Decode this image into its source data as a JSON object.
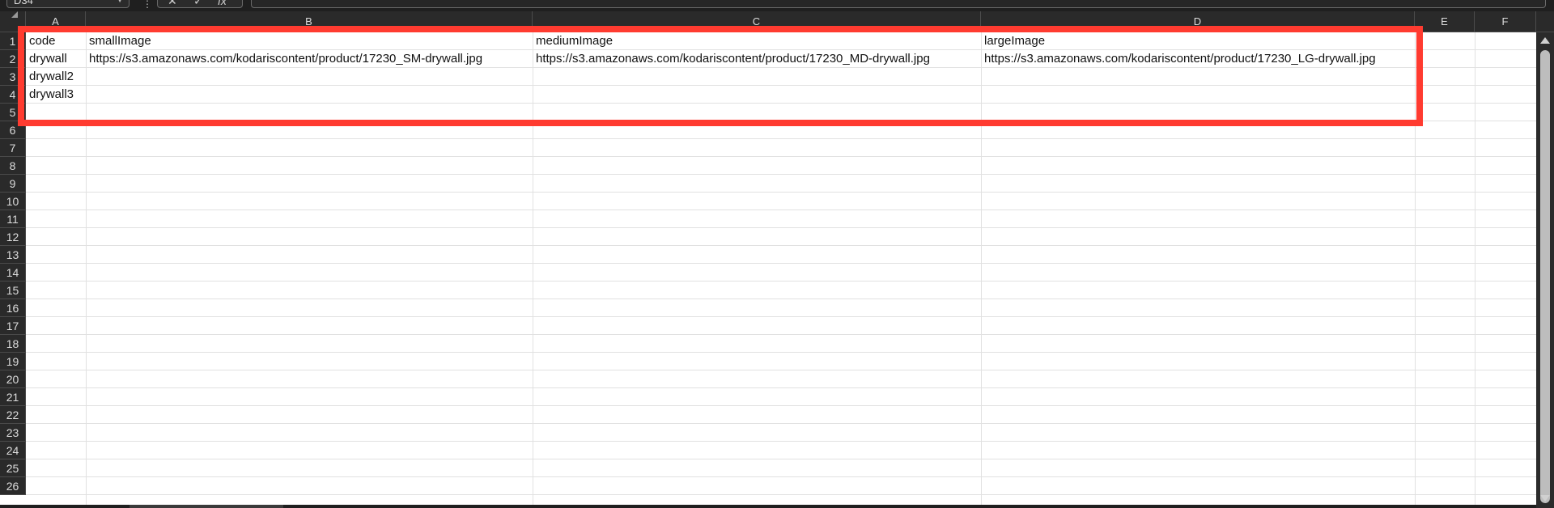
{
  "formula_bar": {
    "name_box": "D34",
    "fx_label": "fx",
    "cancel_symbol": "✕",
    "enter_symbol": "✓",
    "formula_value": ""
  },
  "columns": [
    {
      "id": "A",
      "label": "A"
    },
    {
      "id": "B",
      "label": "B"
    },
    {
      "id": "C",
      "label": "C"
    },
    {
      "id": "D",
      "label": "D"
    },
    {
      "id": "E",
      "label": "E"
    },
    {
      "id": "F",
      "label": "F"
    }
  ],
  "rows": [
    "1",
    "2",
    "3",
    "4",
    "5",
    "6",
    "7",
    "8",
    "9",
    "10",
    "11",
    "12",
    "13",
    "14",
    "15",
    "16",
    "17",
    "18",
    "19",
    "20",
    "21",
    "22",
    "23",
    "24",
    "25",
    "26"
  ],
  "cells": {
    "A1": "code",
    "B1": "smallImage",
    "C1": "mediumImage",
    "D1": "largeImage",
    "A2": "drywall",
    "B2": "https://s3.amazonaws.com/kodariscontent/product/17230_SM-drywall.jpg",
    "C2": "https://s3.amazonaws.com/kodariscontent/product/17230_MD-drywall.jpg",
    "D2": "https://s3.amazonaws.com/kodariscontent/product/17230_LG-drywall.jpg",
    "A3": "drywall2",
    "A4": "drywall3"
  },
  "colors": {
    "highlight": "#ff3b30",
    "header_bg": "#2a2a2a",
    "grid_line": "#e1e1e1"
  }
}
